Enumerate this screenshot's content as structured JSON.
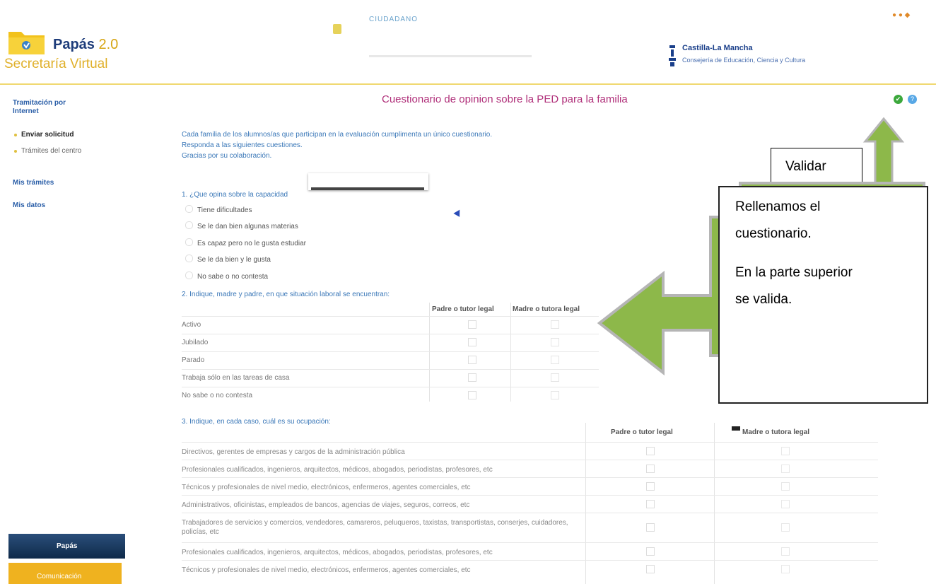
{
  "header": {
    "logo_title": "Papás",
    "logo_version": "2.0",
    "logo_subtitle": "Secretaría Virtual",
    "ciudadano_label": "CIUDADANO",
    "gov_title": "Castilla-La Mancha",
    "gov_subtitle": "Consejería de Educación, Ciencia y Cultura"
  },
  "sidebar": {
    "tramitacion": "Tramitación por Internet",
    "enviar": "Enviar solicitud",
    "tramites_centro": "Trámites del centro",
    "mis_tramites": "Mis trámites",
    "mis_datos": "Mis datos",
    "btn_papas": "Papás",
    "btn_comunicacion": "Comunicación"
  },
  "page": {
    "title": "Cuestionario de opinion sobre la PED para la familia",
    "intro": [
      "Cada familia de los alumnos/as que participan en la evaluación cumplimenta un único cuestionario.",
      "Responda a las siguientes cuestiones.",
      "Gracias por su colaboración."
    ]
  },
  "q1": {
    "question": "1. ¿Que opina sobre la capacidad",
    "options": [
      "Tiene dificultades",
      "Se le dan bien algunas materias",
      "Es capaz pero no le gusta estudiar",
      "Se le da bien y le gusta",
      "No sabe o no contesta"
    ]
  },
  "q2": {
    "question": "2. Indique, madre y padre, en que situación laboral se encuentran:",
    "col1": "Padre o tutor legal",
    "col2": "Madre o tutora legal",
    "rows": [
      "Activo",
      "Jubilado",
      "Parado",
      "Trabaja sólo en las tareas de casa",
      "No sabe o no contesta"
    ]
  },
  "q3": {
    "question": "3. Indique, en cada caso, cuál es su ocupación:",
    "col1": "Padre o tutor legal",
    "col2": "Madre o tutora legal",
    "rows": [
      "Directivos, gerentes de empresas y cargos de la administración pública",
      "Profesionales cualificados, ingenieros, arquitectos, médicos, abogados, periodistas, profesores, etc",
      "Técnicos y profesionales de nivel medio, electrónicos, enfermeros, agentes comerciales, etc",
      "Administrativos, oficinistas, empleados de bancos, agencias de viajes, seguros, correos, etc",
      "Trabajadores de servicios y comercios, vendedores, camareros, peluqueros, taxistas, transportistas, conserjes, cuidadores, policías, etc",
      "Profesionales cualificados, ingenieros, arquitectos, médicos, abogados, periodistas, profesores, etc",
      "Técnicos y profesionales de nivel medio, electrónicos, enfermeros, agentes comerciales, etc"
    ]
  },
  "callouts": {
    "validar": "Validar",
    "note_lines": [
      "Rellenamos el",
      "cuestionario.",
      "En la parte superior",
      "se valida."
    ]
  },
  "colors": {
    "arrow_green": "#8db84a",
    "title_magenta": "#b0307a",
    "link_blue": "#3b78b8"
  }
}
